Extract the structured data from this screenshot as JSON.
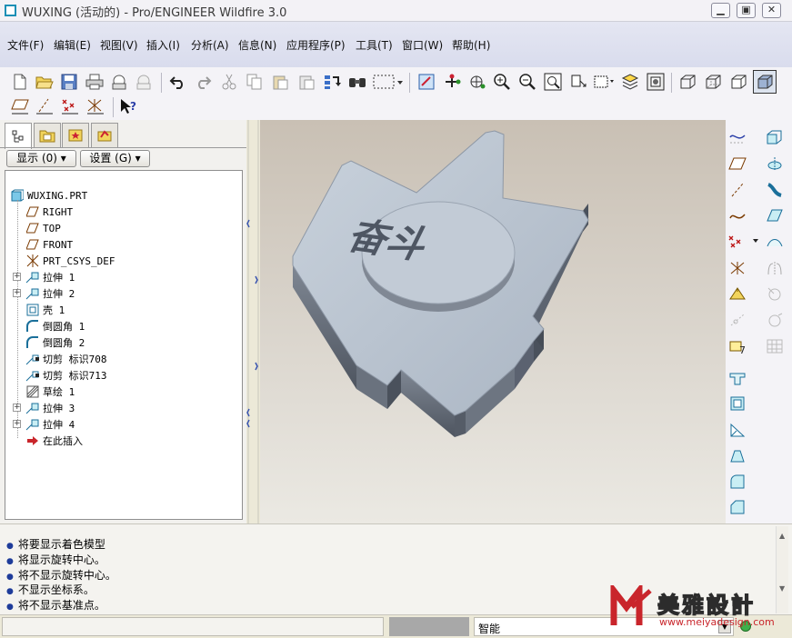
{
  "window": {
    "title": "WUXING (活动的) - Pro/ENGINEER Wildfire 3.0",
    "minimize": "▁",
    "restore": "▣",
    "close": "✕"
  },
  "menubar": [
    "文件(F)",
    "编辑(E)",
    "视图(V)",
    "插入(I)",
    "分析(A)",
    "信息(N)",
    "应用程序(P)",
    "工具(T)",
    "窗口(W)",
    "帮助(H)"
  ],
  "toolbar_icons": [
    "new-icon",
    "open-icon",
    "save-icon",
    "print-icon",
    "send-mail-icon",
    "mail-icon",
    "undo-icon",
    "redo-icon",
    "cut-icon",
    "copy-icon",
    "paste-icon",
    "paste-special-icon",
    "regenerate-icon",
    "find-icon",
    "select-box-icon",
    "repaint-icon",
    "spin-center-icon",
    "orient-icon",
    "zoom-in-icon",
    "zoom-out-icon",
    "refit-icon",
    "reorient-icon",
    "saved-views-icon",
    "layers-icon",
    "view-manager-icon",
    "wireframe-icon",
    "hidden-line-icon",
    "no-hidden-icon",
    "shading-icon",
    "datum-plane-toggle-icon",
    "datum-axis-toggle-icon",
    "datum-point-toggle-icon",
    "csys-toggle-icon",
    "context-help-icon"
  ],
  "model_tree": {
    "tabs": [
      "model-tree-tab",
      "folder-browser-tab",
      "favorites-tab",
      "connections-tab"
    ],
    "show_button": "显示 (0) ▾",
    "settings_button": "设置 (G) ▾",
    "root": "WUXING.PRT",
    "items": [
      {
        "label": "RIGHT",
        "icon": "datum-plane-icon",
        "expandable": false
      },
      {
        "label": "TOP",
        "icon": "datum-plane-icon",
        "expandable": false
      },
      {
        "label": "FRONT",
        "icon": "datum-plane-icon",
        "expandable": false
      },
      {
        "label": "PRT_CSYS_DEF",
        "icon": "csys-icon",
        "expandable": false
      },
      {
        "label": "拉伸 1",
        "icon": "extrude-icon",
        "expandable": true
      },
      {
        "label": "拉伸 2",
        "icon": "extrude-icon",
        "expandable": true
      },
      {
        "label": "壳 1",
        "icon": "shell-icon",
        "expandable": false
      },
      {
        "label": "倒圆角 1",
        "icon": "round-icon",
        "expandable": false
      },
      {
        "label": "倒圆角 2",
        "icon": "round-icon",
        "expandable": false
      },
      {
        "label": "切剪 标识708",
        "icon": "cut-feature-icon",
        "expandable": false
      },
      {
        "label": "切剪 标识713",
        "icon": "cut-feature-icon",
        "expandable": false
      },
      {
        "label": "草绘 1",
        "icon": "sketch-icon",
        "expandable": false
      },
      {
        "label": "拉伸 3",
        "icon": "extrude-icon",
        "expandable": true
      },
      {
        "label": "拉伸 4",
        "icon": "extrude-icon",
        "expandable": true
      },
      {
        "label": "在此插入",
        "icon": "insert-here-arrow-icon",
        "expandable": false
      }
    ]
  },
  "viewport": {
    "engraved_text": "奋斗",
    "model_color": "#b8c2cf"
  },
  "right_toolbar": {
    "col1": [
      "sketched-datum-curve-icon",
      "datum-plane-icon",
      "datum-axis-icon",
      "datum-curve-icon",
      "datum-point-icon",
      "datum-csys-icon",
      "analysis-feature-icon",
      "datum-pattern-icon",
      "annotation-icon",
      "hole-icon",
      "shell-tool-icon",
      "rib-icon",
      "draft-icon",
      "round-tool-icon",
      "chamfer-icon"
    ],
    "col2": [
      "extrude-tool-icon",
      "revolve-tool-icon",
      "sweep-tool-icon",
      "blend-tool-icon",
      "boundary-blend-icon",
      "mirror-icon",
      "merge-icon",
      "trim-icon",
      "intersect-icon",
      "pattern-icon"
    ]
  },
  "messages": [
    "将要显示着色模型",
    "将显示旋转中心。",
    "将不显示旋转中心。",
    "不显示坐标系。",
    "将不显示基准点。"
  ],
  "statusbar": {
    "filter": "智能"
  },
  "watermark": {
    "brand": "美雅設計",
    "url": "www.meiyadesign.com"
  }
}
